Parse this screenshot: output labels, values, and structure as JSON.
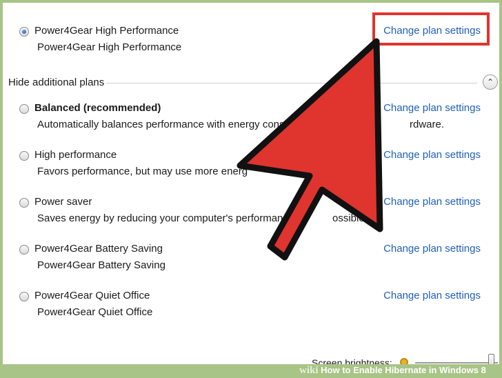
{
  "active_plan": {
    "name": "Power4Gear High Performance",
    "description": "Power4Gear High Performance",
    "link": "Change plan settings",
    "selected": true
  },
  "hide_additional_label": "Hide additional plans",
  "collapse_icon": "chevron-up-icon",
  "plans": [
    {
      "name": "Balanced (recommended)",
      "description": "Automatically balances performance with energy consum",
      "description_tail": "rdware.",
      "link": "Change plan settings"
    },
    {
      "name": "High performance",
      "description": "Favors performance, but may use more energ",
      "link": "Change plan settings"
    },
    {
      "name": "Power saver",
      "description": "Saves energy by reducing your computer's performanc",
      "description_tail": "ossible.",
      "link": "Change plan settings"
    },
    {
      "name": "Power4Gear Battery Saving",
      "description": "Power4Gear Battery Saving",
      "link": "Change plan settings"
    },
    {
      "name": "Power4Gear Quiet Office",
      "description": "Power4Gear Quiet Office",
      "link": "Change plan settings"
    }
  ],
  "brightness": {
    "label": "Screen brightness:",
    "level": 0.92
  },
  "banner": {
    "wiki": "wiki",
    "title": "How to Enable Hibernate in Windows 8"
  },
  "colors": {
    "link": "#1f5fb8",
    "arrow": "#e0342f",
    "highlight": "#e0342f",
    "frame": "#a8c486"
  }
}
